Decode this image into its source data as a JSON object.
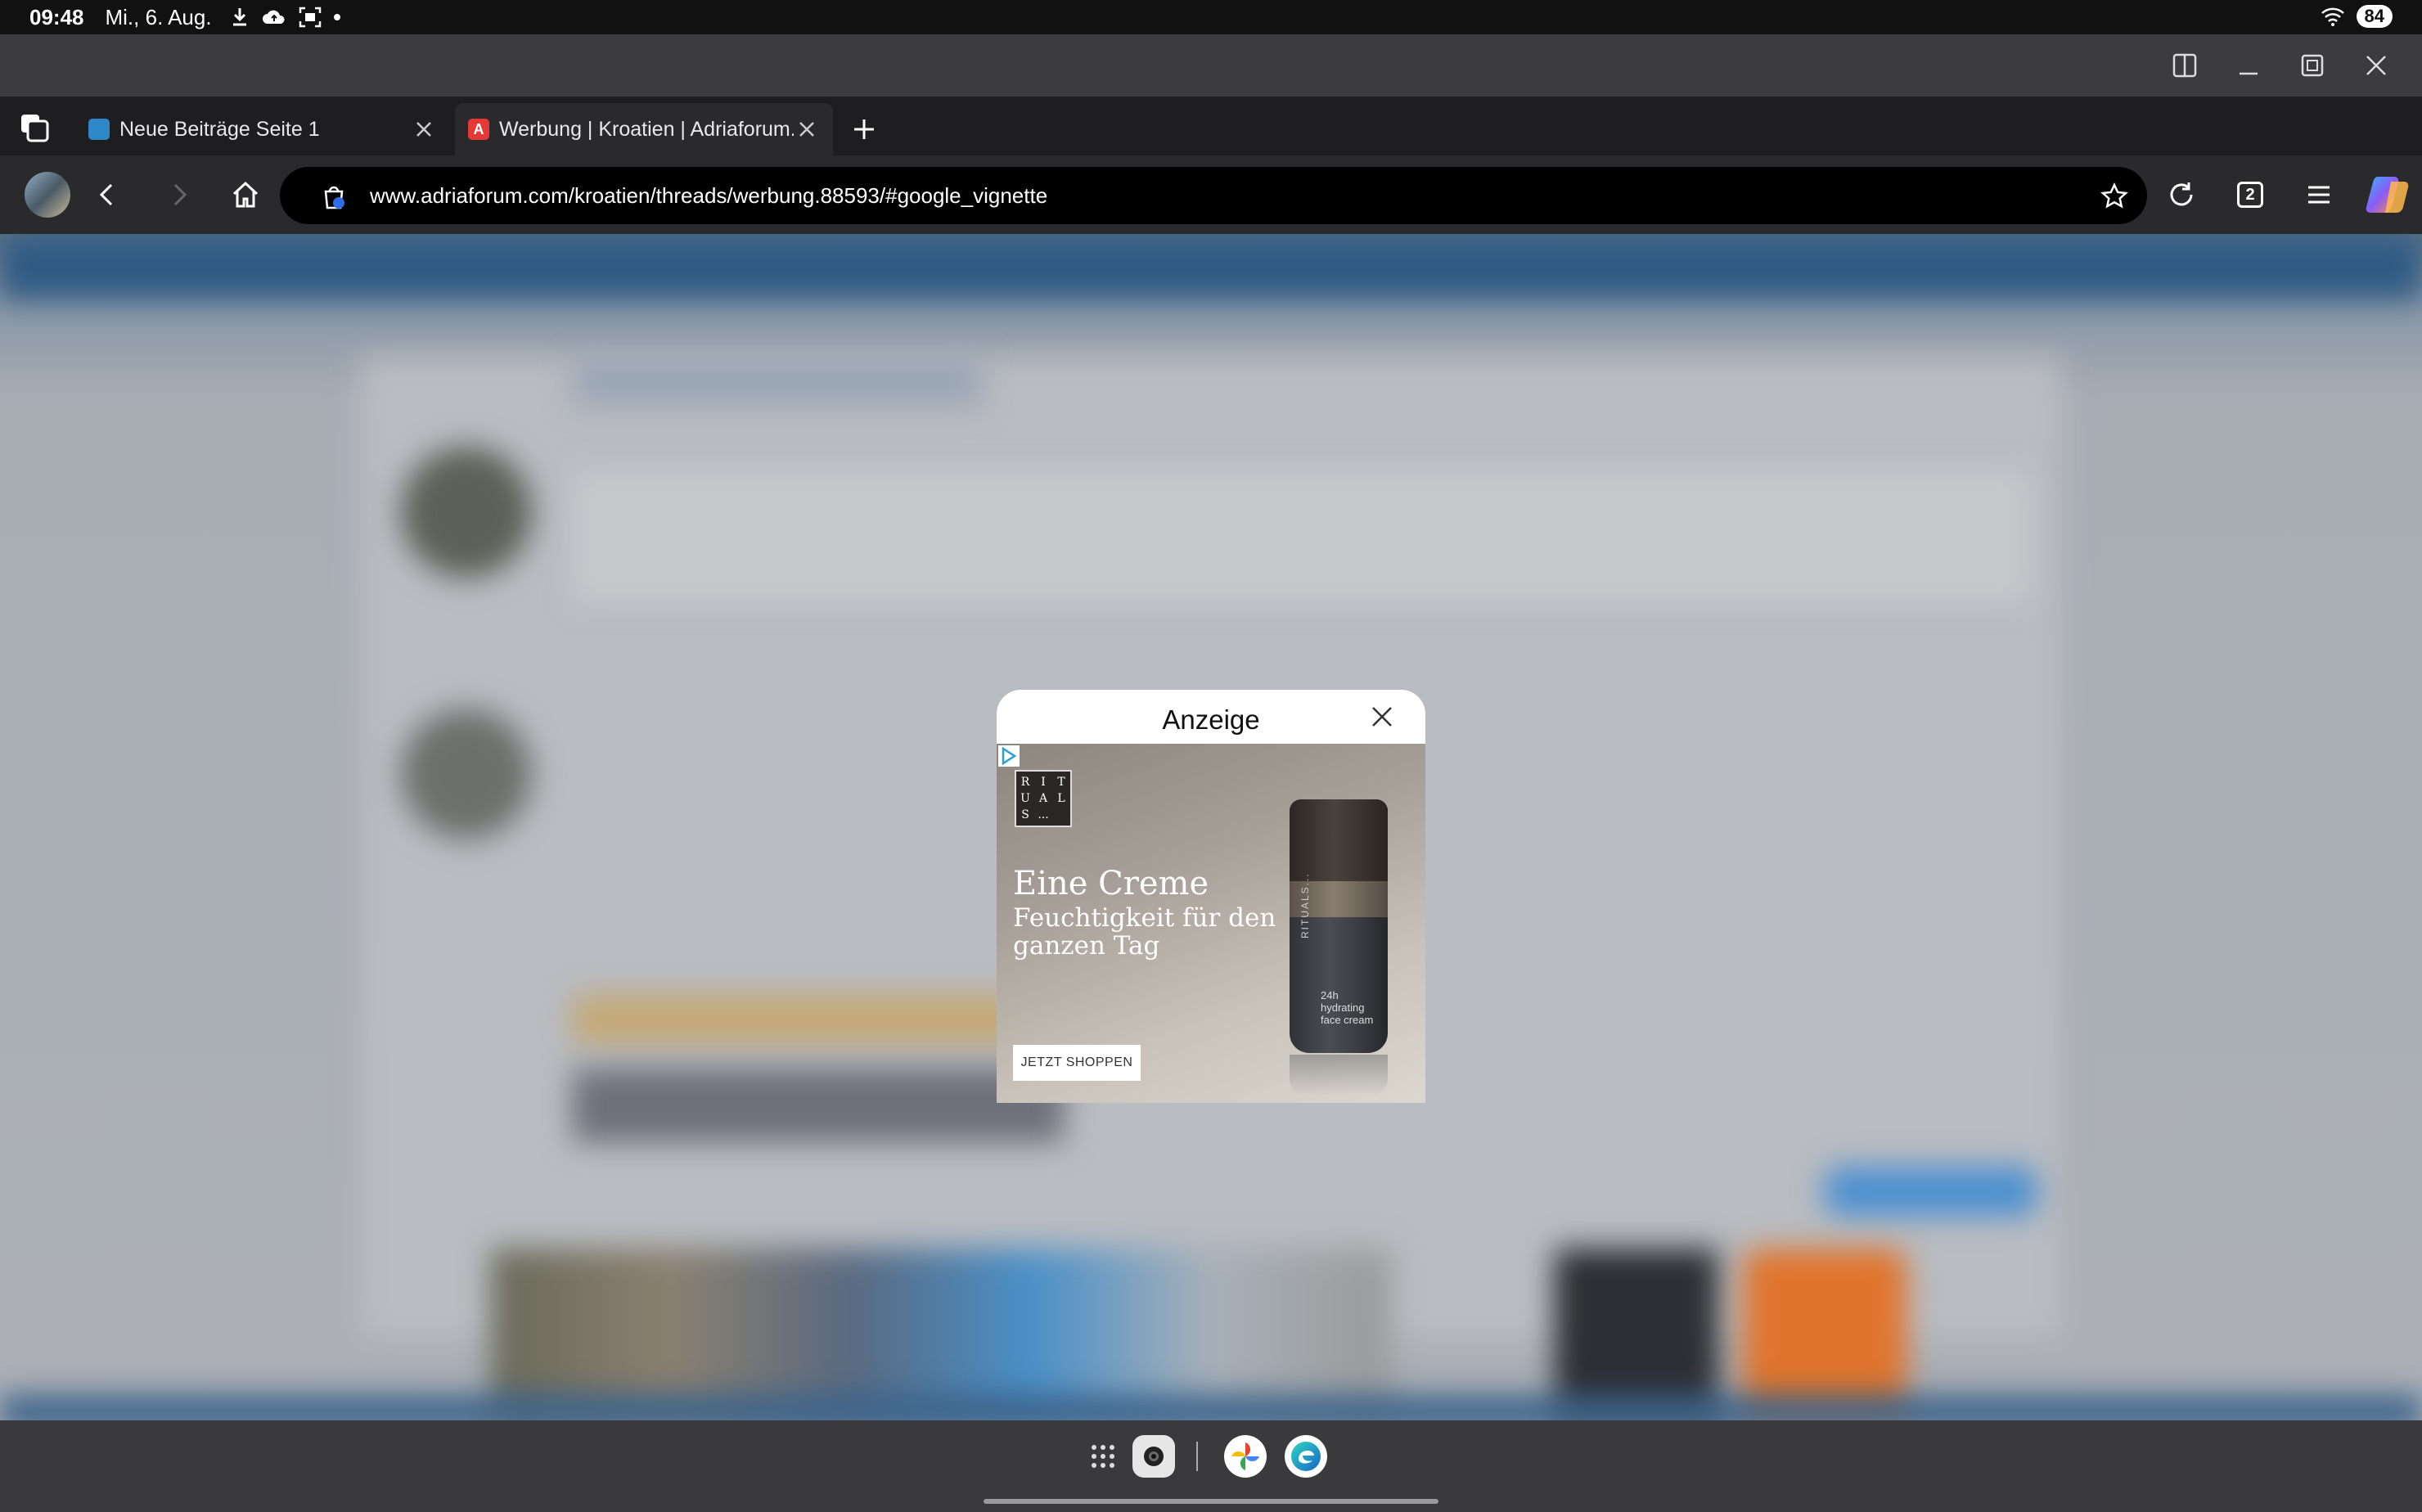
{
  "status_bar": {
    "time": "09:48",
    "date": "Mi., 6. Aug.",
    "battery": "84"
  },
  "tabs": [
    {
      "title": "Neue Beiträge Seite 1",
      "icon": "forum-favicon-icon",
      "active": false
    },
    {
      "title": "Werbung | Kroatien | Adriaforum.c",
      "icon": "adriaforum-favicon-icon",
      "favicon_letter": "A",
      "active": true
    }
  ],
  "address_bar": {
    "url": "www.adriaforum.com/kroatien/threads/werbung.88593/#google_vignette"
  },
  "toolbar": {
    "tab_count": "2"
  },
  "ad": {
    "title": "Anzeige",
    "brand_letters": [
      "R",
      "I",
      "T",
      "U",
      "A",
      "L",
      "S",
      "..."
    ],
    "headline": "Eine Creme",
    "subline": "Feuchtigkeit für den ganzen Tag",
    "cta": "JETZT SHOPPEN",
    "product_brand": "RITUALS...",
    "product_label": "24h hydrating face cream"
  },
  "colors": {
    "accent_active_tab": "#e53935",
    "url_text": "#ffffff"
  }
}
